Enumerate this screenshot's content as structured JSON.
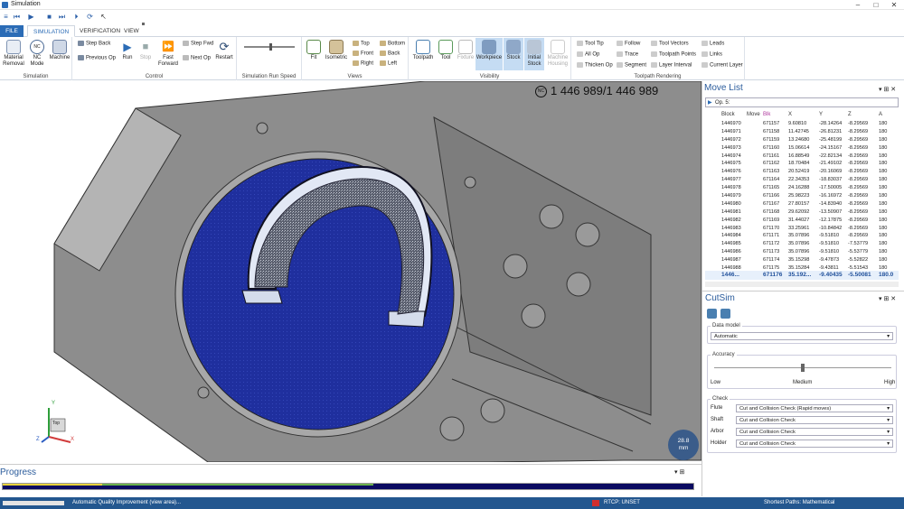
{
  "window": {
    "title": "Simulation"
  },
  "tabs": {
    "file": "FILE",
    "simulation": "SIMULATION",
    "verification": "VERIFICATION",
    "view": "VIEW"
  },
  "ribbon": {
    "simulation_group": {
      "label": "Simulation",
      "material_removal": "Material Removal",
      "nc_mode": "NC Mode",
      "machine": "Machine"
    },
    "control_group": {
      "label": "Control",
      "step_back": "Step Back",
      "previous_op": "Previous Op",
      "run": "Run",
      "stop": "Stop",
      "fast_forward": "Fast Forward",
      "step_fwd": "Step Fwd",
      "next_op": "Next Op",
      "restart": "Restart"
    },
    "speed_group": {
      "label": "Simulation Run Speed"
    },
    "views_group": {
      "label": "Views",
      "fit": "Fit",
      "isometric": "Isometric",
      "top": "Top",
      "front": "Front",
      "right": "Right",
      "bottom": "Bottom",
      "back": "Back",
      "left": "Left"
    },
    "visibility_group": {
      "label": "Visibility",
      "toolpath": "Toolpath",
      "tool": "Tool",
      "fixture": "Fixture",
      "workpiece": "Workpiece",
      "stock": "Stock",
      "initial_stock": "Initial Stock",
      "machine_housing": "Machine Housing"
    },
    "toolpath_rendering_group": {
      "label": "Toolpath Rendering",
      "tool_tip": "Tool Tip",
      "all_op": "All Op",
      "thicken_op": "Thicken Op",
      "follow": "Follow",
      "trace": "Trace",
      "segment": "Segment",
      "tool_vectors": "Tool Vectors",
      "toolpath_points": "Toolpath Points",
      "layer_interval": "Layer Interval",
      "leads": "Leads",
      "links": "Links",
      "current_layer": "Current Layer"
    }
  },
  "viewport": {
    "nc_badge": "NC",
    "counter": "1 446 989/1 446 989",
    "zoom_value": "28.8",
    "zoom_unit": "mm",
    "view_cube_label": "Top",
    "axis_x": "X",
    "axis_y": "Y",
    "axis_z": "Z"
  },
  "progress": {
    "title": "Progress",
    "percent": 100
  },
  "statusbar": {
    "left": "Automatic Quality Improvement (view area)...",
    "rtcp": "RTCP: UNSET",
    "right": "Shortest Paths: Mathematical"
  },
  "move_list": {
    "title": "Move List",
    "op_selector": "Op. 5:",
    "columns": [
      "Block",
      "Move",
      "Blk",
      "X",
      "Y",
      "Z",
      "A"
    ],
    "rows": [
      [
        "1446970",
        "",
        "671157",
        "9.60810",
        "-28.14264",
        "-8.29569",
        "180"
      ],
      [
        "1446971",
        "",
        "671158",
        "11.42745",
        "-26.81231",
        "-8.29569",
        "180"
      ],
      [
        "1446972",
        "",
        "671159",
        "13.24680",
        "-25.48199",
        "-8.29569",
        "180"
      ],
      [
        "1446973",
        "",
        "671160",
        "15.06614",
        "-24.15167",
        "-8.29569",
        "180"
      ],
      [
        "1446974",
        "",
        "671161",
        "16.88549",
        "-22.82134",
        "-8.29569",
        "180"
      ],
      [
        "1446975",
        "",
        "671162",
        "18.70484",
        "-21.49102",
        "-8.29569",
        "180"
      ],
      [
        "1446976",
        "",
        "671163",
        "20.52419",
        "-20.16069",
        "-8.29569",
        "180"
      ],
      [
        "1446977",
        "",
        "671164",
        "22.34353",
        "-18.83037",
        "-8.29569",
        "180"
      ],
      [
        "1446978",
        "",
        "671165",
        "24.16288",
        "-17.50005",
        "-8.29569",
        "180"
      ],
      [
        "1446979",
        "",
        "671166",
        "25.98223",
        "-16.16972",
        "-8.29569",
        "180"
      ],
      [
        "1446980",
        "",
        "671167",
        "27.80157",
        "-14.83940",
        "-8.29569",
        "180"
      ],
      [
        "1446981",
        "",
        "671168",
        "29.62092",
        "-13.50907",
        "-8.29569",
        "180"
      ],
      [
        "1446982",
        "",
        "671169",
        "31.44027",
        "-12.17875",
        "-8.29569",
        "180"
      ],
      [
        "1446983",
        "",
        "671170",
        "33.25961",
        "-10.84842",
        "-8.29569",
        "180"
      ],
      [
        "1446984",
        "",
        "671171",
        "35.07896",
        "-9.51810",
        "-8.29569",
        "180"
      ],
      [
        "1446985",
        "",
        "671172",
        "35.07896",
        "-9.51810",
        "-7.53779",
        "180"
      ],
      [
        "1446986",
        "",
        "671173",
        "35.07896",
        "-9.51810",
        "-5.53779",
        "180"
      ],
      [
        "1446987",
        "",
        "671174",
        "35.15298",
        "-9.47873",
        "-5.52822",
        "180"
      ],
      [
        "1446988",
        "",
        "671175",
        "35.15284",
        "-9.43811",
        "-5.51543",
        "180"
      ]
    ],
    "current_row": [
      "1446...",
      "",
      "671176",
      "35.192...",
      "-9.40435",
      "-5.50081",
      "180.0"
    ]
  },
  "cutsim": {
    "title": "CutSim",
    "data_model_label": "Data model",
    "data_model_value": "Automatic",
    "accuracy_label": "Accuracy",
    "accuracy_level": 0.5,
    "accuracy_low": "Low",
    "accuracy_medium": "Medium",
    "accuracy_high": "High",
    "check_label": "Check",
    "checks": [
      {
        "label": "Flute",
        "value": "Cut and Collision Check (Rapid moves)"
      },
      {
        "label": "Shaft",
        "value": "Cut and Collision Check"
      },
      {
        "label": "Arbor",
        "value": "Cut and Collision Check"
      },
      {
        "label": "Holder",
        "value": "Cut and Collision Check"
      }
    ]
  },
  "colors": {
    "accent": "#2b6cb6",
    "statusbar": "#23578f",
    "stock_blue": "#1f2f9e",
    "part_grey": "#8d8d8d"
  }
}
